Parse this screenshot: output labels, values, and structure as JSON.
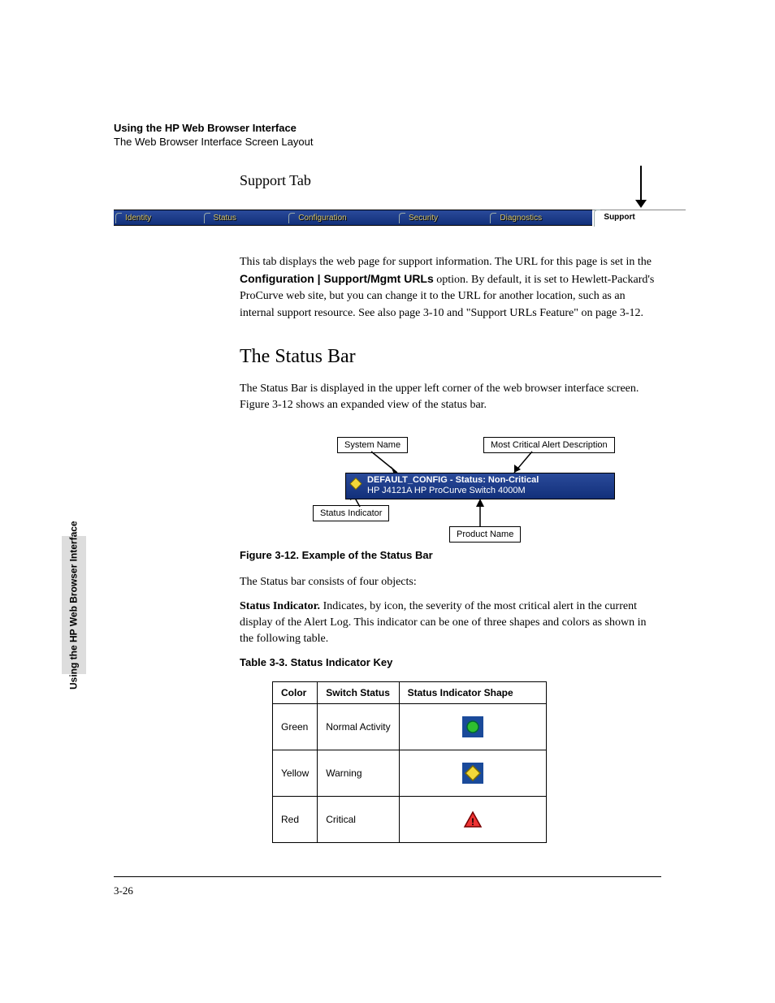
{
  "header": {
    "title": "Using the HP Web Browser Interface",
    "subtitle": "The Web Browser Interface Screen Layout"
  },
  "section1": {
    "heading": "Support Tab",
    "para1_a": "This tab displays the web page for support information. The URL for this page is set in the ",
    "para1_bold": "Configuration | Support/Mgmt URLs",
    "para1_b": " option. By default, it is set to Hewlett-Packard's ProCurve web site, but you can change it to the URL for another location, such as an internal support resource. See also page 3-10 and \"Support URLs Feature\" on page 3-12."
  },
  "tabs": [
    "Identity",
    "Status",
    "Configuration",
    "Security",
    "Diagnostics",
    "Support"
  ],
  "section2": {
    "heading": "The Status Bar",
    "para": "The Status Bar is displayed in the upper left corner of the web browser interface screen. Figure 3-12 shows an expanded view of the status bar."
  },
  "figure": {
    "callouts": {
      "system_name": "System Name",
      "alert_desc": "Most Critical Alert Description",
      "status_indicator": "Status Indicator",
      "product_name": "Product Name"
    },
    "strip": {
      "line1": "DEFAULT_CONFIG - Status:  Non-Critical",
      "line2": "HP J4121A HP ProCurve Switch 4000M"
    },
    "caption": "Figure 3-12.   Example of the Status Bar"
  },
  "para_four": "The Status bar consists of four objects:",
  "status_ind": {
    "label": "Status Indicator.",
    "text": "  Indicates, by icon, the severity of the most critical alert in the current display of the Alert Log. This indicator can be one of three shapes and colors as shown in the following table."
  },
  "table": {
    "caption": "Table 3-3.      Status Indicator Key",
    "headers": [
      "Color",
      "Switch Status",
      "Status Indicator Shape"
    ],
    "rows": [
      {
        "color": "Green",
        "status": "Normal Activity",
        "shape": "green"
      },
      {
        "color": "Yellow",
        "status": "Warning",
        "shape": "yellow"
      },
      {
        "color": "Red",
        "status": "Critical",
        "shape": "red"
      }
    ]
  },
  "side_tab": "Using the HP Web Browser\nInterface",
  "page_number": "3-26"
}
